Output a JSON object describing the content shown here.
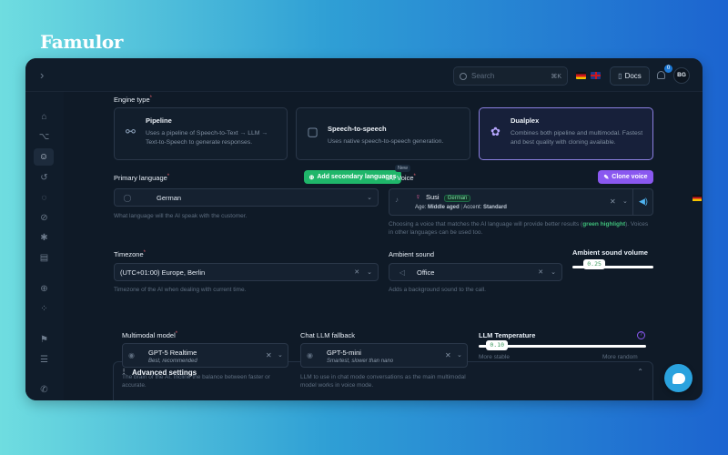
{
  "brand": "Famulor",
  "topbar": {
    "search_placeholder": "Search",
    "search_shortcut": "⌘K",
    "docs_label": "Docs",
    "notification_count": "0",
    "avatar_initials": "BG"
  },
  "engine": {
    "label": "Engine type",
    "options": [
      {
        "title": "Pipeline",
        "desc": "Uses a pipeline of Speech-to-Text → LLM → Text-to-Speech to generate responses.",
        "icon": "pipeline-icon"
      },
      {
        "title": "Speech-to-speech",
        "desc": "Uses native speech-to-speech generation.",
        "icon": "speech-to-speech-icon"
      },
      {
        "title": "Dualplex",
        "desc": "Combines both pipeline and multimodal. Fastest and best quality with cloning available.",
        "icon": "brain-icon"
      }
    ],
    "selected": "Dualplex"
  },
  "primary_language": {
    "label": "Primary language",
    "value": "German",
    "help": "What language will the AI speak with the customer.",
    "add_secondary_label": "Add secondary languages",
    "new_badge": "New"
  },
  "ai_voice": {
    "label": "AI Voice",
    "clone_label": "Clone voice",
    "name": "Susi",
    "language_tag": "German",
    "age_label": "Age:",
    "age_value": "Middle aged",
    "accent_label": "Accent:",
    "accent_value": "Standard",
    "help_prefix": "Choosing a voice that matches the AI language will provide better results (",
    "help_highlight": "green highlight",
    "help_suffix": "). Voices in other languages can be used too."
  },
  "timezone": {
    "label": "Timezone",
    "value": "(UTC+01:00) Europe, Berlin",
    "help": "Timezone of the AI when dealing with current time."
  },
  "ambient_sound": {
    "label": "Ambient sound",
    "value": "Office",
    "help": "Adds a background sound to the call."
  },
  "ambient_volume": {
    "label": "Ambient sound volume",
    "value_text": "0.25",
    "value": 0.25
  },
  "advanced": {
    "title": "Advanced settings",
    "multimodal": {
      "label": "Multimodal model",
      "value": "GPT-5 Realtime",
      "sub": "Best, recommended",
      "help": "The brain of the AI. Incline the balance between faster or accurate."
    },
    "chat_fallback": {
      "label": "Chat LLM fallback",
      "value": "GPT-5-mini",
      "sub": "Smartest, slower than nano",
      "help": "LLM to use in chat mode conversations as the main multimodal model works in voice mode."
    },
    "temperature": {
      "label": "LLM Temperature",
      "value_text": "0.10",
      "value": 0.1,
      "min_label": "More stable",
      "max_label": "More random"
    }
  },
  "colors": {
    "accent_green": "#1fb66a",
    "accent_purple": "#8a58f0",
    "selected_border": "#8b7fe0"
  }
}
